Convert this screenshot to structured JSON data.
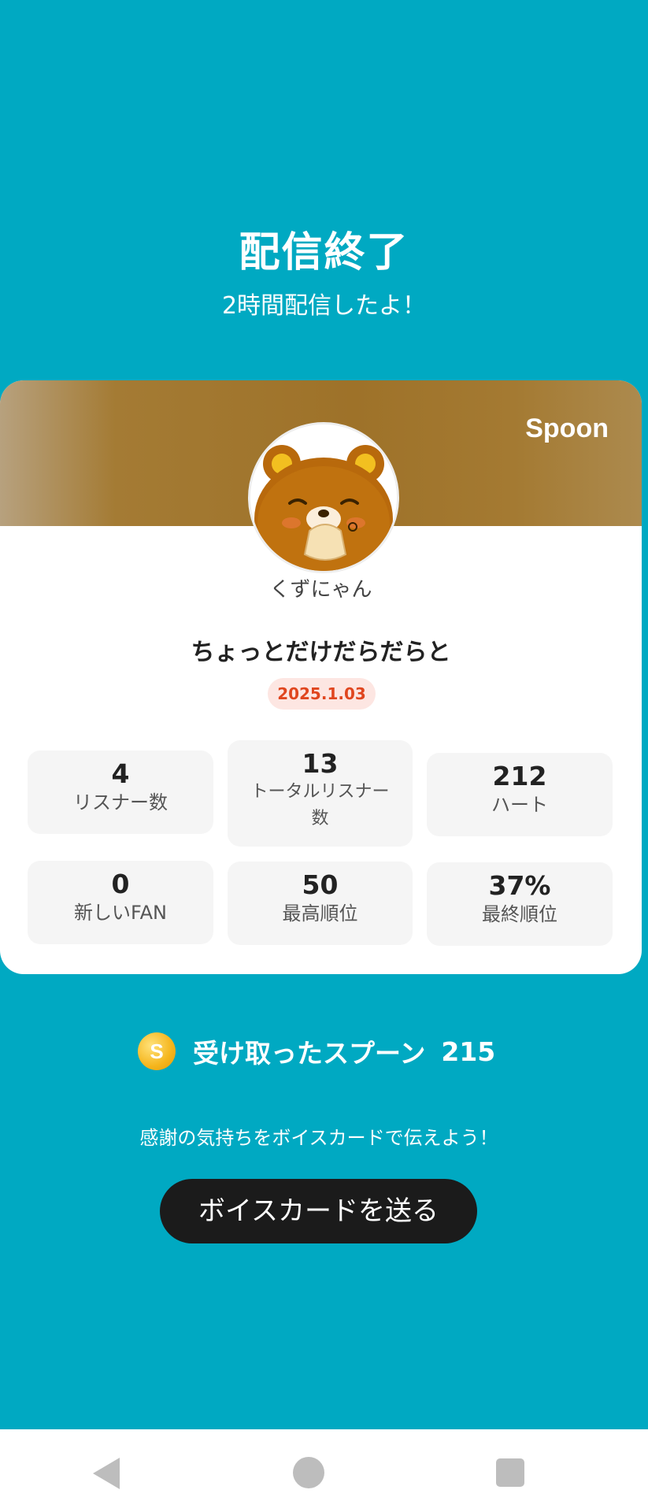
{
  "header": {
    "title": "配信終了",
    "subtitle": "2時間配信したよ！"
  },
  "card": {
    "brand": "Spoon",
    "username": "くずにゃん",
    "live_title": "ちょっとだけだらだらと",
    "date": "2025.1.03",
    "stats": [
      {
        "value": "4",
        "label": "リスナー数"
      },
      {
        "value": "13",
        "label": "トータルリスナー数"
      },
      {
        "value": "212",
        "label": "ハート"
      },
      {
        "value": "0",
        "label": "新しいFAN"
      },
      {
        "value": "50",
        "label": "最高順位"
      },
      {
        "value": "37%",
        "label": "最終順位"
      }
    ]
  },
  "spoons": {
    "coin_symbol": "S",
    "label": "受け取ったスプーン",
    "value": "215"
  },
  "thanks_message": "感謝の気持ちをボイスカードで伝えよう！",
  "voice_card_button": "ボイスカードを送る",
  "colors": {
    "background": "#00a9c2",
    "banner": "#9e7229",
    "date_badge_text": "#e0461f",
    "button": "#1b1b1b"
  },
  "icons": {
    "coin": "spoon-coin-icon",
    "nav_back": "back-triangle-icon",
    "nav_home": "home-circle-icon",
    "nav_recent": "recent-square-icon"
  }
}
